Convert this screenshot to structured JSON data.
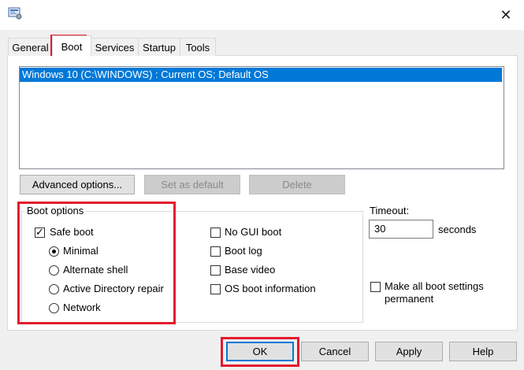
{
  "window": {
    "close_glyph": "✕"
  },
  "tabs": [
    {
      "label": "General"
    },
    {
      "label": "Boot"
    },
    {
      "label": "Services"
    },
    {
      "label": "Startup"
    },
    {
      "label": "Tools"
    }
  ],
  "active_tab": "Boot",
  "os_list": {
    "items": [
      {
        "label": "Windows 10 (C:\\WINDOWS) : Current OS; Default OS",
        "selected": true
      }
    ]
  },
  "buttons": {
    "advanced": "Advanced options...",
    "set_default": "Set as default",
    "delete": "Delete",
    "ok": "OK",
    "cancel": "Cancel",
    "apply": "Apply",
    "help": "Help"
  },
  "boot_options": {
    "legend": "Boot options",
    "safe_boot": {
      "label": "Safe boot",
      "checked": true
    },
    "modes": [
      {
        "label": "Minimal",
        "selected": true
      },
      {
        "label": "Alternate shell",
        "selected": false
      },
      {
        "label": "Active Directory repair",
        "selected": false
      },
      {
        "label": "Network",
        "selected": false
      }
    ],
    "no_gui_boot": {
      "label": "No GUI boot",
      "checked": false
    },
    "boot_log": {
      "label": "Boot log",
      "checked": false
    },
    "base_video": {
      "label": "Base video",
      "checked": false
    },
    "os_boot_info": {
      "label": "OS boot information",
      "checked": false
    }
  },
  "timeout": {
    "label": "Timeout:",
    "value": "30",
    "unit": "seconds"
  },
  "make_permanent": {
    "label_line1": "Make all boot settings",
    "label_line2": "permanent",
    "checked": false
  },
  "colors": {
    "selection": "#0078d7",
    "highlight": "#e21b2d"
  }
}
